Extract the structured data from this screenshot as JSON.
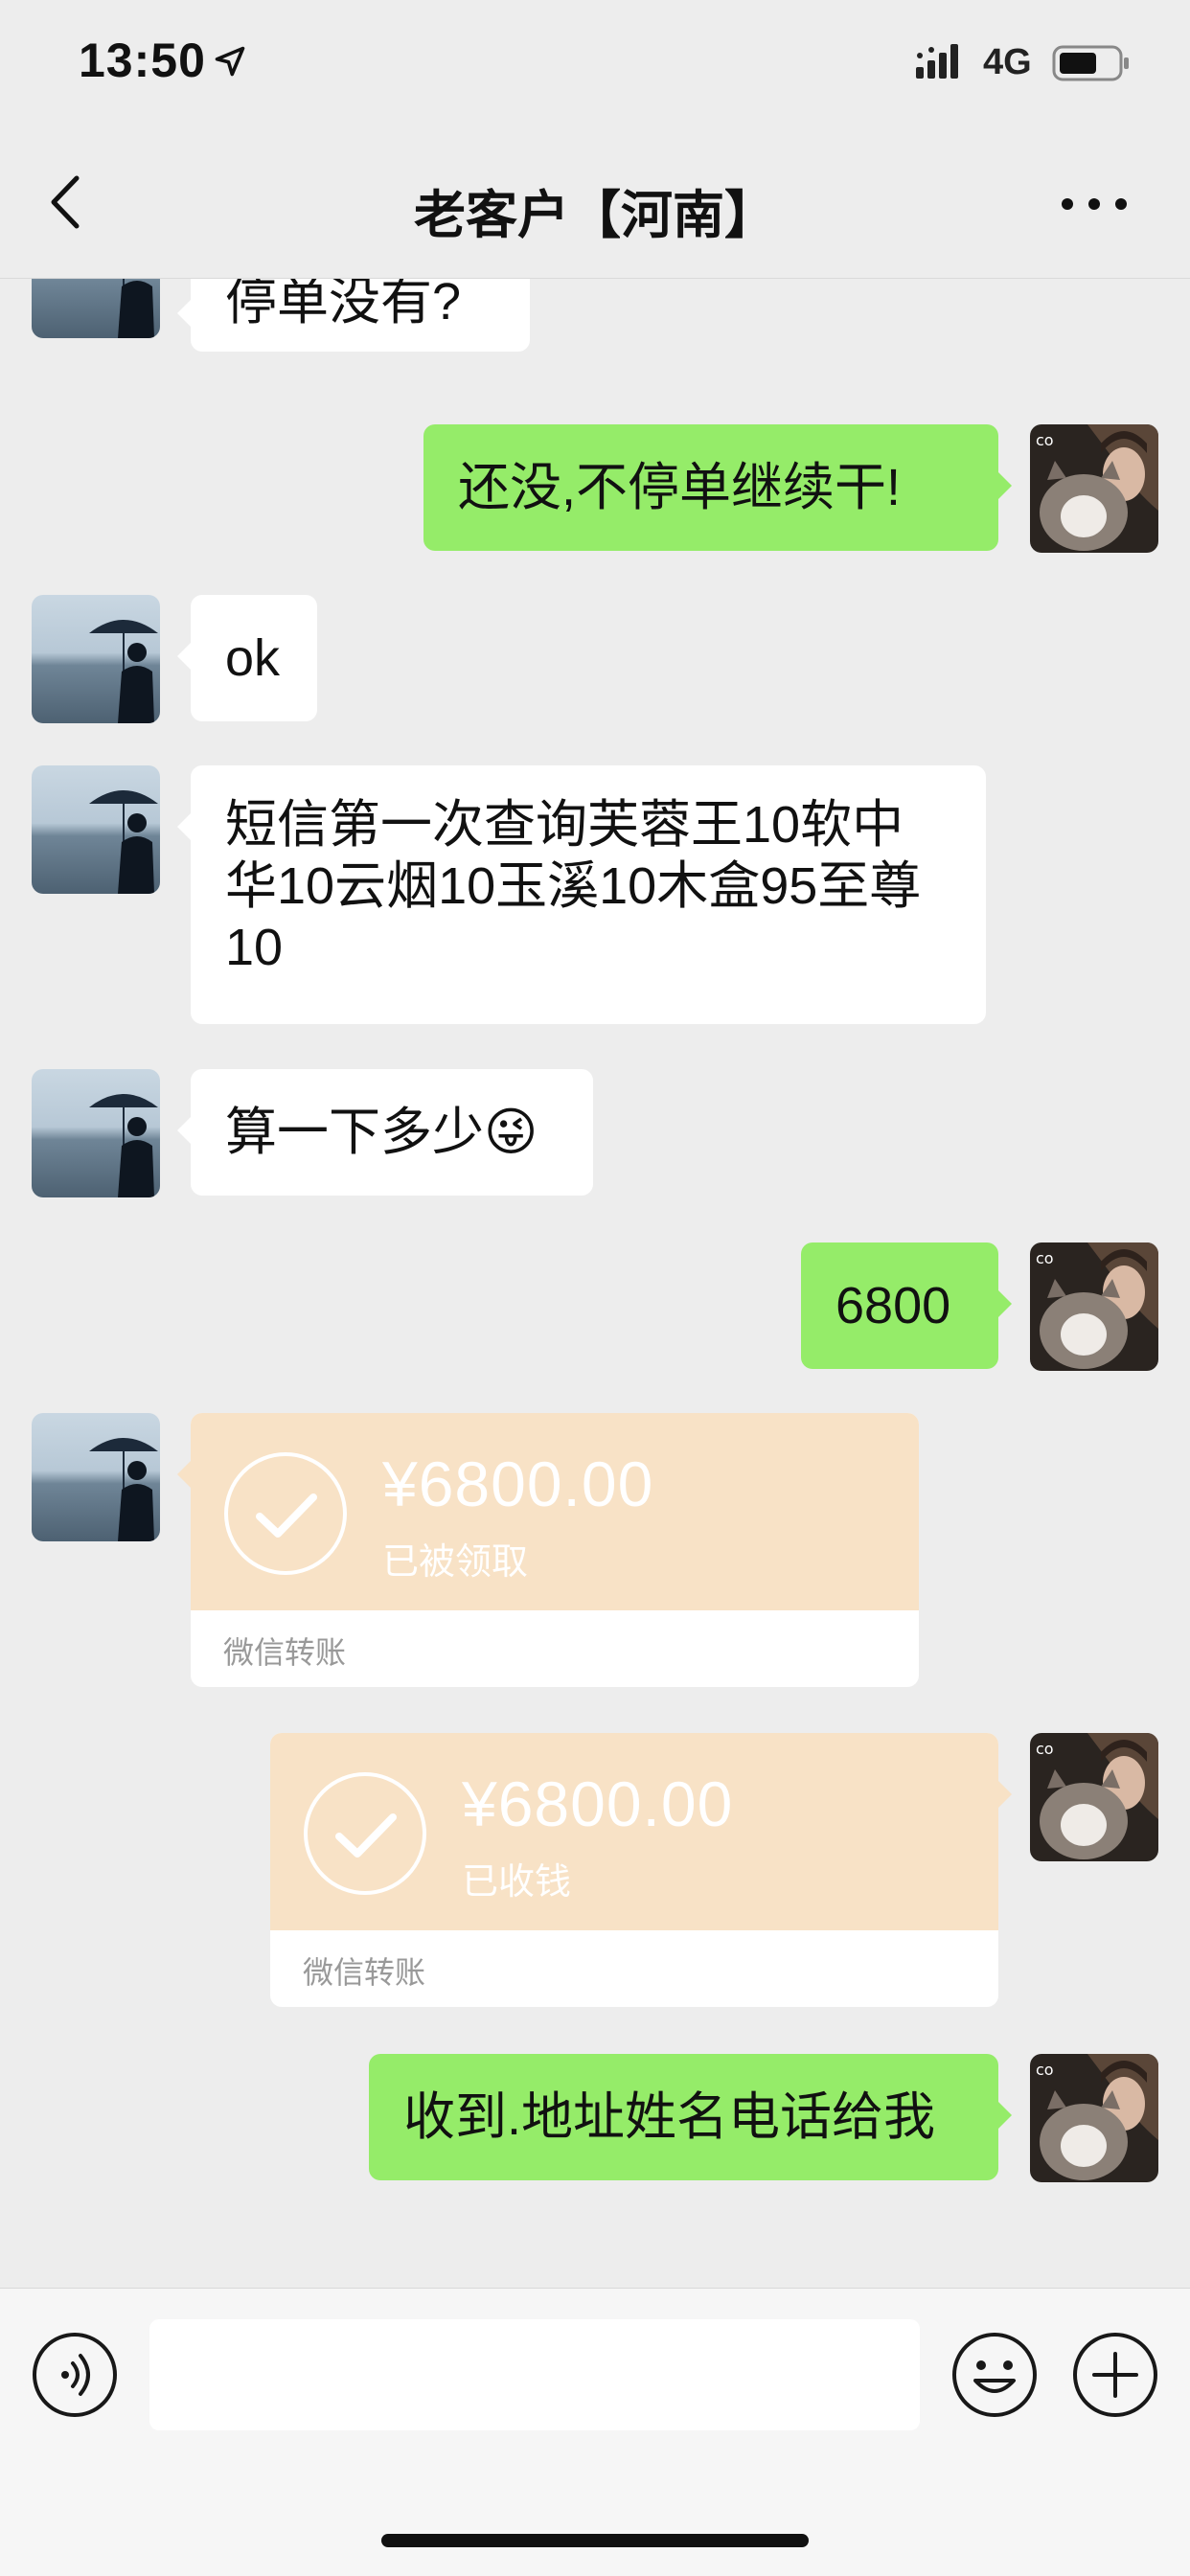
{
  "status_bar": {
    "time": "13:50",
    "network": "4G",
    "icons": [
      "location-arrow-icon",
      "signal-icon",
      "battery-icon"
    ]
  },
  "nav": {
    "title": "老客户【河南】",
    "back_icon": "chevron-left-icon",
    "more_icon": "more-dots-icon"
  },
  "messages": [
    {
      "side": "left",
      "type": "text",
      "text": "停单没有?"
    },
    {
      "side": "right",
      "type": "text",
      "text": "还没,不停单继续干!"
    },
    {
      "side": "left",
      "type": "text",
      "text": "ok"
    },
    {
      "side": "left",
      "type": "text",
      "text": "短信第一次查询芙蓉王10软中华10云烟10玉溪10木盒95至尊10"
    },
    {
      "side": "left",
      "type": "text",
      "text": "算一下多少",
      "emoji": "😜"
    },
    {
      "side": "right",
      "type": "text",
      "text": "6800"
    },
    {
      "side": "left",
      "type": "transfer",
      "amount": "¥6800.00",
      "status": "已被领取",
      "footer": "微信转账"
    },
    {
      "side": "right",
      "type": "transfer",
      "amount": "¥6800.00",
      "status": "已收钱",
      "footer": "微信转账"
    },
    {
      "side": "right",
      "type": "text",
      "text": "收到.地址姓名电话给我"
    }
  ],
  "input_bar": {
    "placeholder": "",
    "icons": [
      "voice-icon",
      "emoji-icon",
      "plus-icon"
    ]
  },
  "colors": {
    "background": "#EDEDED",
    "bubble_green": "#95EC69",
    "bubble_white": "#FFFFFF",
    "transfer_bg": "#F8E2C6"
  }
}
